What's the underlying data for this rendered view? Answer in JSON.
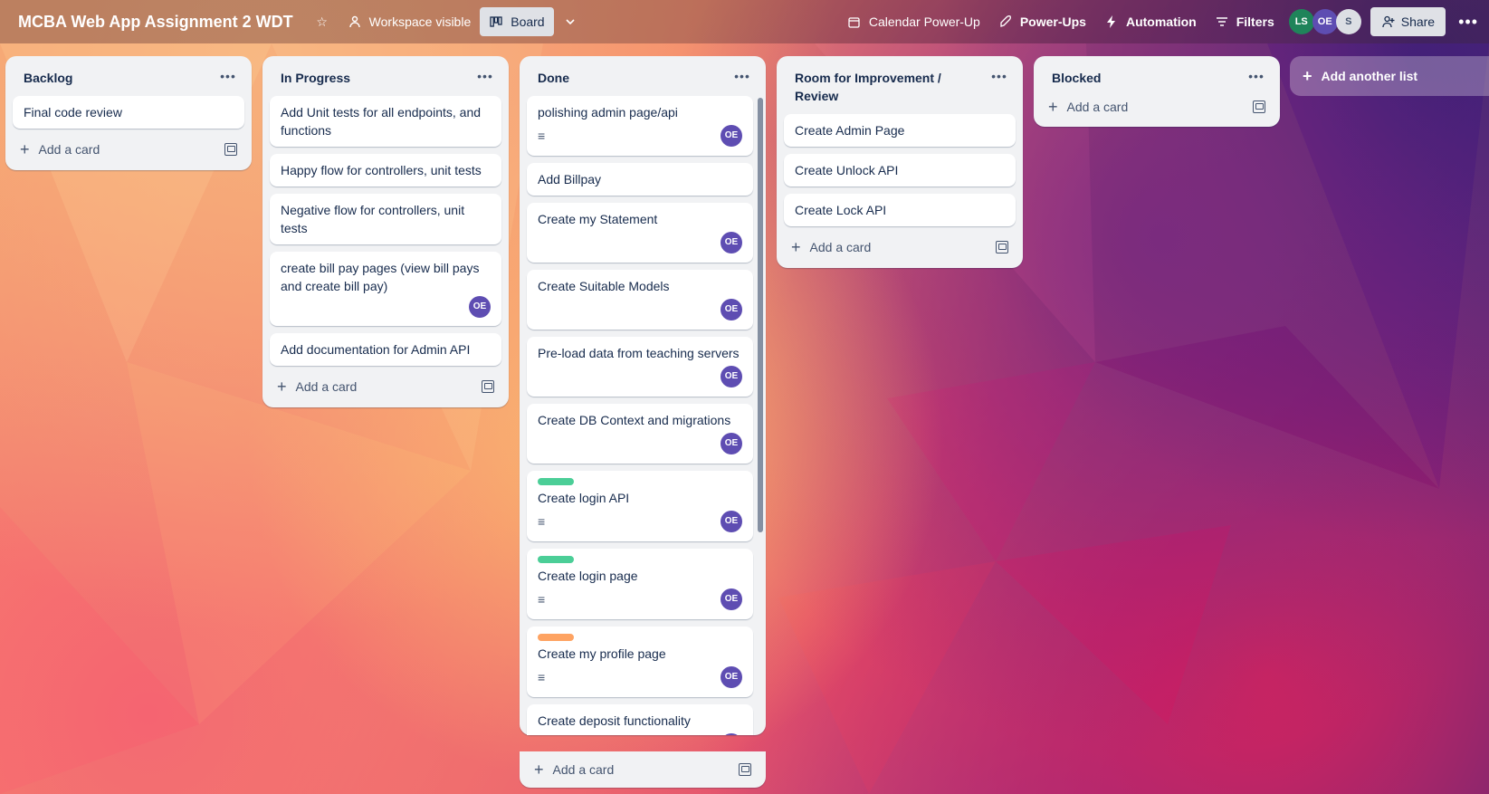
{
  "topbar": {
    "title": "MCBA Web App Assignment 2 WDT",
    "visibility": "Workspace visible",
    "view": "Board",
    "calendar": "Calendar Power-Up",
    "powerups": "Power-Ups",
    "automation": "Automation",
    "filters": "Filters",
    "members": [
      {
        "initials": "LS",
        "color": "#1f845a"
      },
      {
        "initials": "OE",
        "color": "#5e4db2"
      },
      {
        "initials": "S",
        "color": "#dcdfe4"
      }
    ],
    "share": "Share"
  },
  "lists": [
    {
      "title": "Backlog",
      "cards": [
        {
          "text": "Final code review"
        }
      ],
      "add": "Add a card"
    },
    {
      "title": "In Progress",
      "cards": [
        {
          "text": "Add Unit tests for all endpoints, and functions"
        },
        {
          "text": "Happy flow for controllers, unit tests"
        },
        {
          "text": "Negative flow for controllers, unit tests"
        },
        {
          "text": "create bill pay pages (view bill pays and create bill pay)",
          "member": "OE"
        },
        {
          "text": "Add documentation for Admin API"
        }
      ],
      "add": "Add a card"
    },
    {
      "title": "Done",
      "cards": [
        {
          "text": "polishing admin page/api",
          "desc": true,
          "member": "OE"
        },
        {
          "text": "Add Billpay"
        },
        {
          "text": "Create my Statement",
          "member": "OE"
        },
        {
          "text": "Create Suitable Models",
          "member": "OE"
        },
        {
          "text": "Pre-load data from teaching servers",
          "member": "OE"
        },
        {
          "text": "Create DB Context and migrations",
          "member": "OE"
        },
        {
          "text": "Create login API",
          "label": "#4bce97",
          "desc": true,
          "member": "OE"
        },
        {
          "text": "Create login page",
          "label": "#4bce97",
          "desc": true,
          "member": "OE"
        },
        {
          "text": "Create my profile page",
          "label": "#fea362",
          "desc": true,
          "member": "OE"
        },
        {
          "text": "Create deposit functionality",
          "member": "OE"
        }
      ],
      "add": "Add a card"
    },
    {
      "title": "Room for Improvement / Review",
      "cards": [
        {
          "text": "Create Admin Page"
        },
        {
          "text": "Create Unlock API"
        },
        {
          "text": "Create Lock API"
        }
      ],
      "add": "Add a card"
    },
    {
      "title": "Blocked",
      "cards": [],
      "add": "Add a card"
    }
  ],
  "add_list": "Add another list",
  "icons": {
    "star": "star-icon",
    "visibility": "people-icon",
    "board": "board-icon",
    "chevron": "chevron-down-icon",
    "calendar": "calendar-icon",
    "rocket": "rocket-icon",
    "bolt": "lightning-icon",
    "filter": "filter-icon",
    "share": "person-add-icon",
    "more": "more-icon",
    "description": "description-icon",
    "template": "card-template-icon"
  }
}
